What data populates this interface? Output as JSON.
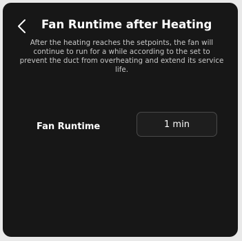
{
  "header": {
    "title": "Fan Runtime after Heating",
    "back_icon": "chevron-left-icon"
  },
  "description": "After the heating reaches the setpoints, the fan will continue to run for a while according to the set to prevent the duct from overheating and extend its service life.",
  "setting": {
    "label": "Fan Runtime",
    "value": "1 min"
  },
  "colors": {
    "background": "#171717",
    "text": "#ffffff",
    "muted_text": "#c7c7c7",
    "button_border": "#4a4a4a"
  }
}
